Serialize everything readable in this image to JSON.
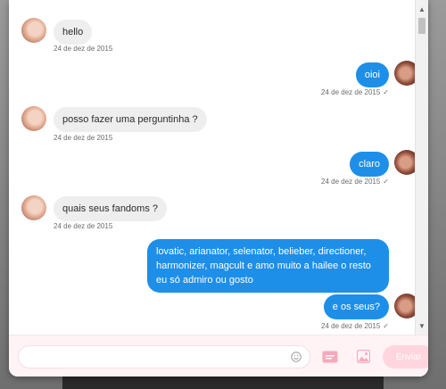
{
  "messages": [
    {
      "from": "them",
      "text": "hello",
      "time": "24 de dez de 2015"
    },
    {
      "from": "me",
      "text": "oioi",
      "time": "24 de dez de 2015",
      "read_mark": "✓"
    },
    {
      "from": "them",
      "text": "posso fazer uma perguntinha ?",
      "time": "24 de dez de 2015"
    },
    {
      "from": "me",
      "text": "claro",
      "time": "24 de dez de 2015",
      "read_mark": "✓"
    },
    {
      "from": "them",
      "text": "quais seus fandoms ?",
      "time": "24 de dez de 2015"
    },
    {
      "from": "me",
      "text": "lovatic, arianator, selenator, belieber, directioner, harmonizer, magcult e amo muito a hailee o resto eu só admiro ou gosto"
    },
    {
      "from": "me",
      "text": "e os seus?",
      "time": "24 de dez de 2015",
      "read_mark": "✓"
    }
  ],
  "composer": {
    "placeholder": "",
    "send_label": "Enviar"
  },
  "icons": {
    "emoji": "smiley-icon",
    "gif": "gif-icon",
    "image": "image-icon"
  },
  "colors": {
    "my_bubble": "#1e8fe8",
    "their_bubble": "#eeeeee",
    "send_button": "#ffd6df"
  }
}
